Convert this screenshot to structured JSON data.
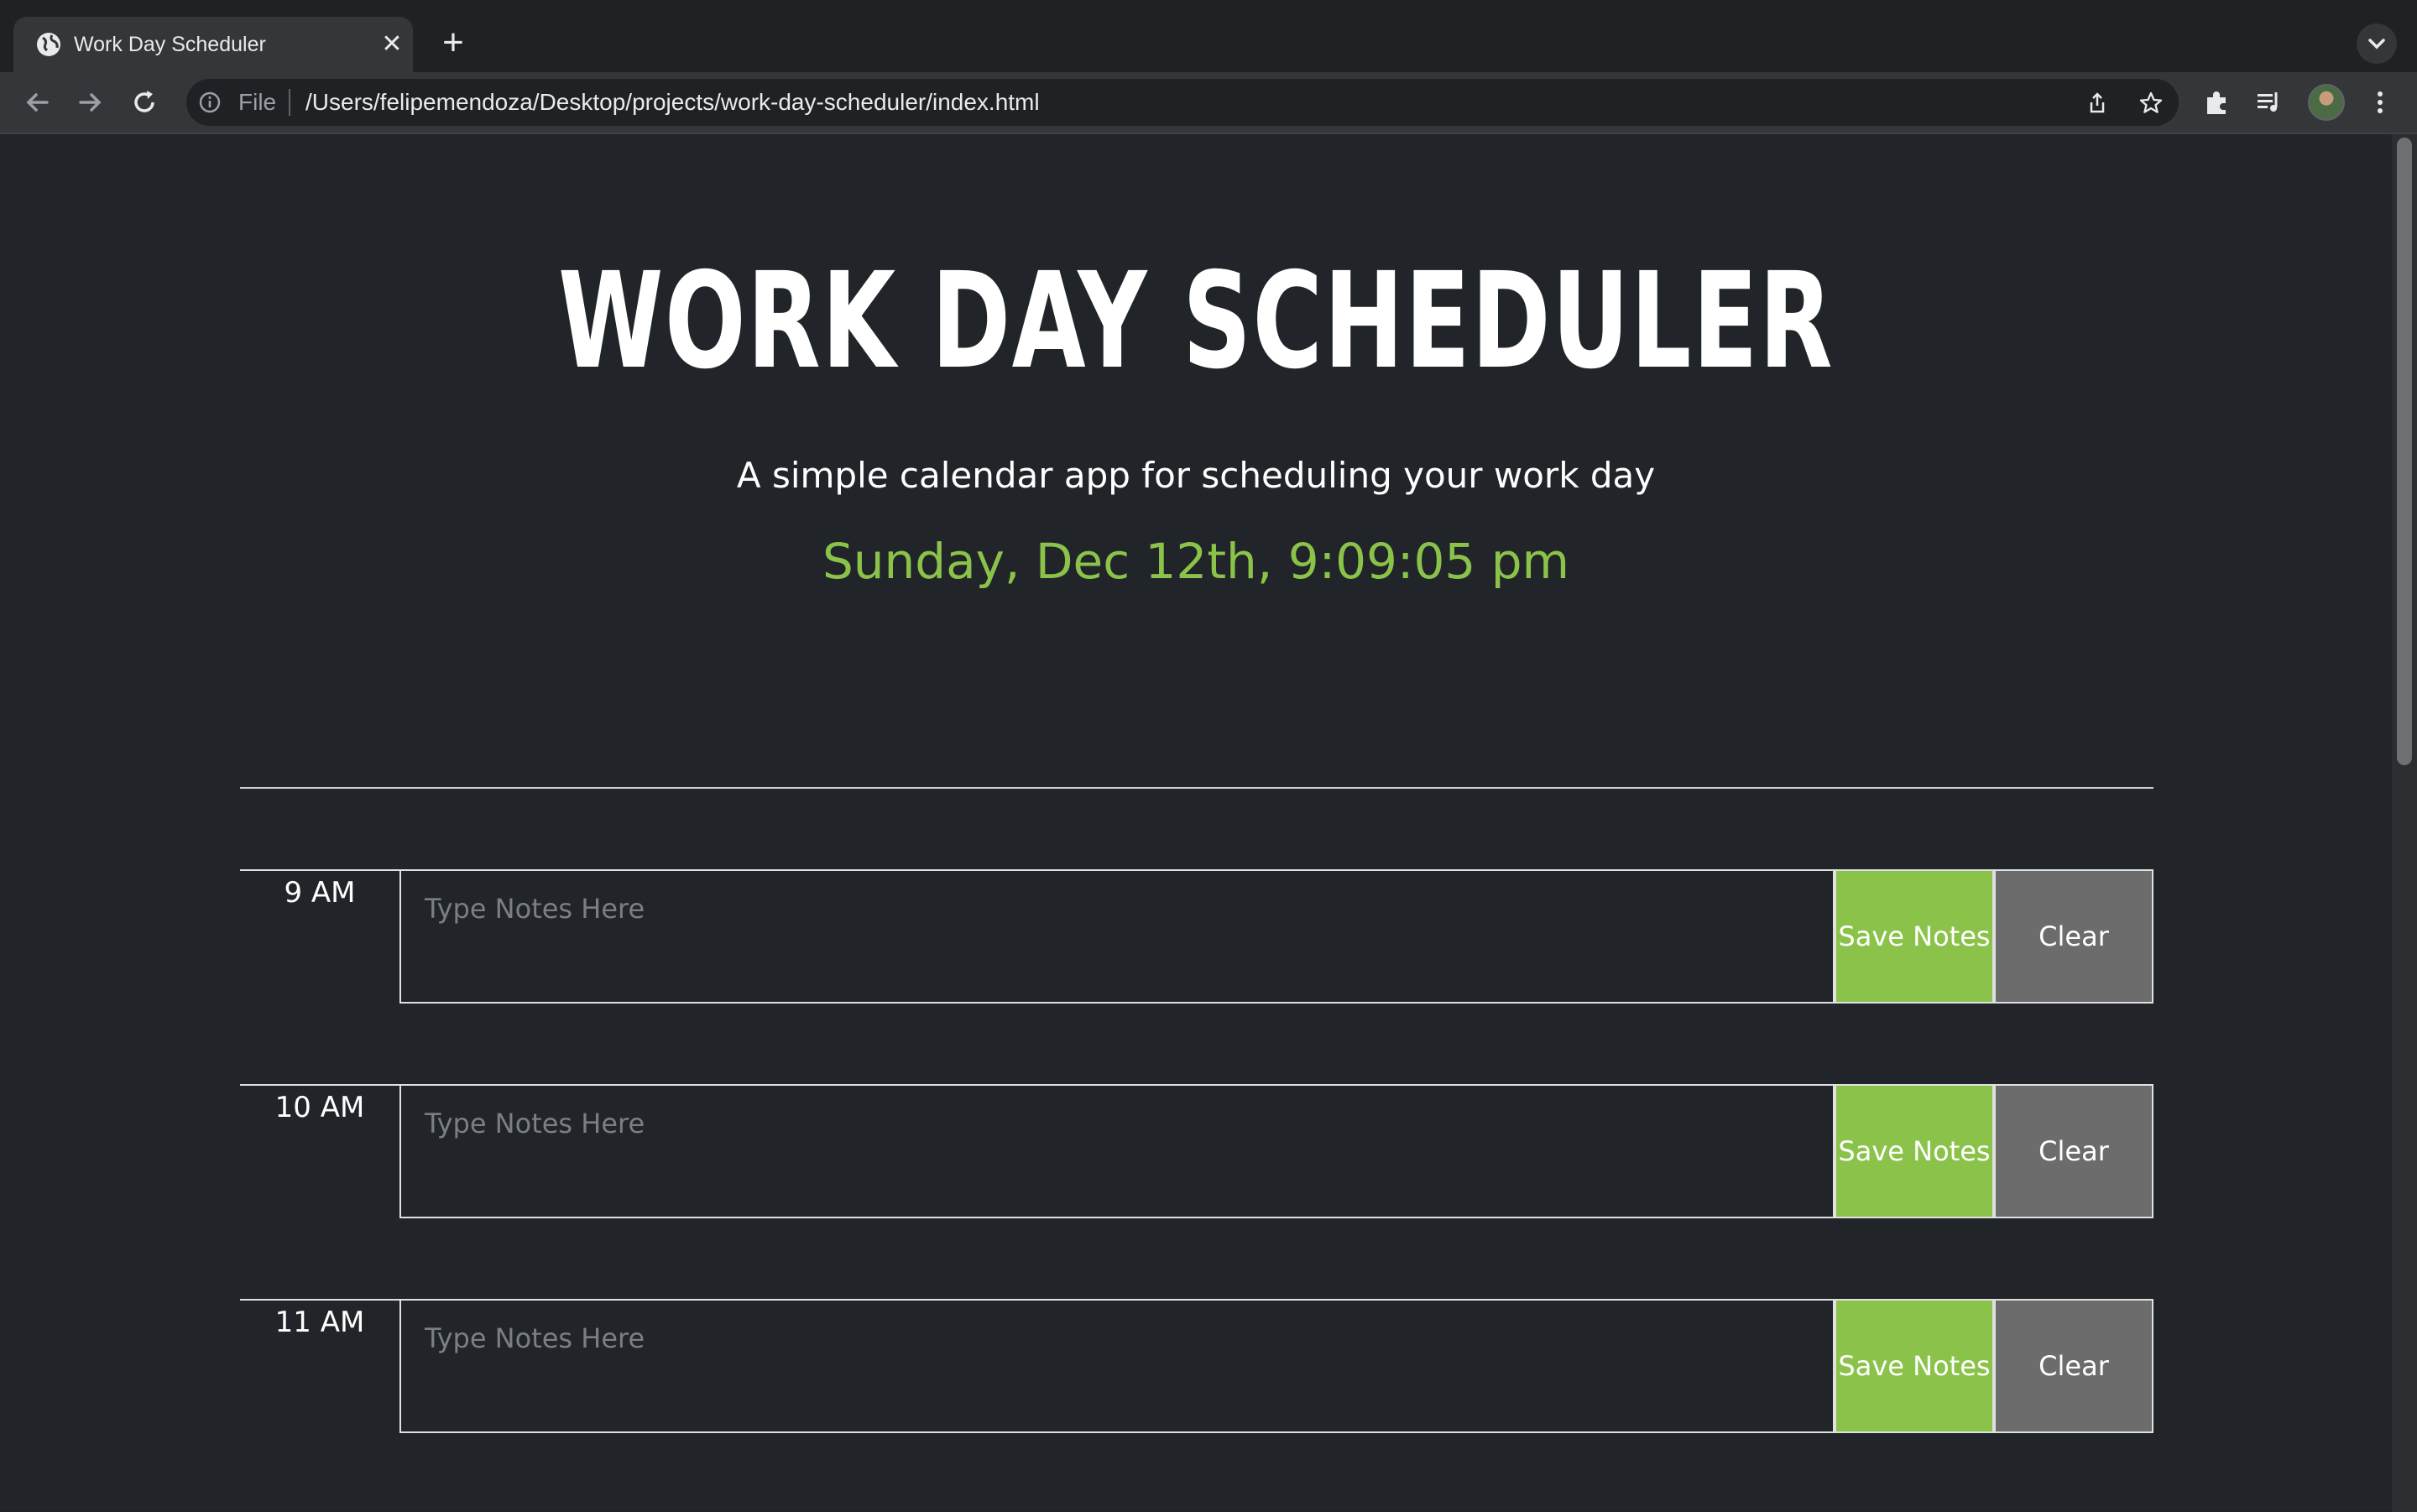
{
  "browser": {
    "tab_title": "Work Day Scheduler",
    "omnibox_scheme": "File",
    "omnibox_url": "/Users/felipemendoza/Desktop/projects/work-day-scheduler/index.html"
  },
  "header": {
    "title": "WORK DAY SCHEDULER",
    "subtitle": "A simple calendar app for scheduling your work day",
    "current_datetime": "Sunday, Dec 12th, 9:09:05 pm"
  },
  "timeblocks": [
    {
      "hour": "9 AM",
      "placeholder": "Type Notes Here",
      "save_label": "Save Notes",
      "clear_label": "Clear"
    },
    {
      "hour": "10 AM",
      "placeholder": "Type Notes Here",
      "save_label": "Save Notes",
      "clear_label": "Clear"
    },
    {
      "hour": "11 AM",
      "placeholder": "Type Notes Here",
      "save_label": "Save Notes",
      "clear_label": "Clear"
    }
  ],
  "colors": {
    "accent_green": "#8bc34a",
    "clear_gray": "#6c6c6c",
    "page_background": "#212529"
  },
  "icons": {
    "tab_favicon": "globe-icon",
    "tab_close": "close-icon",
    "new_tab": "plus-icon",
    "back": "back-arrow-icon",
    "forward": "forward-arrow-icon",
    "reload": "reload-icon",
    "site_info": "info-icon",
    "share": "share-icon",
    "bookmark": "star-icon",
    "extensions": "puzzle-icon",
    "media": "media-queue-icon",
    "menu": "kebab-menu-icon"
  }
}
